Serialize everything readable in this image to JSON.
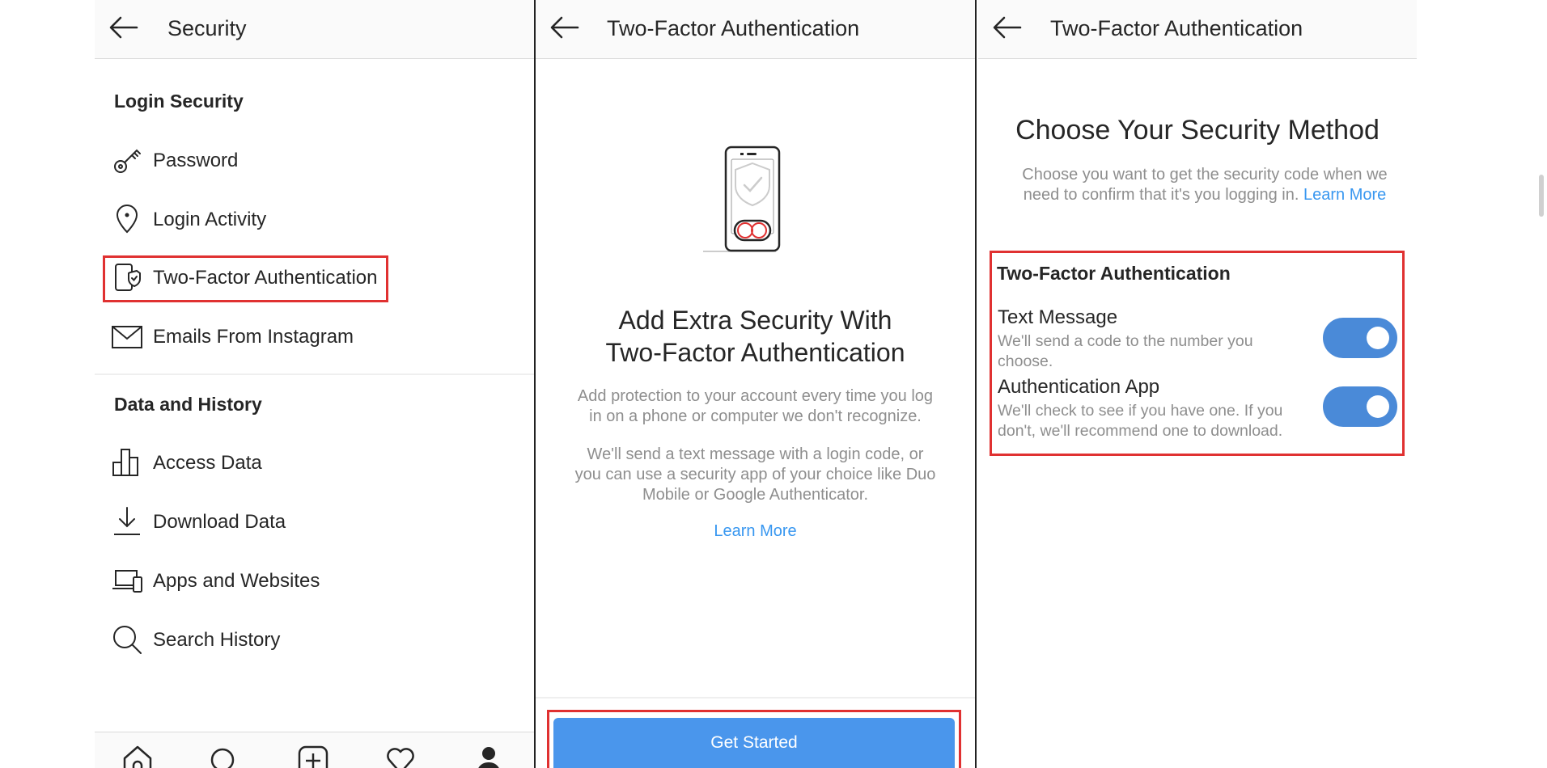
{
  "panel_security": {
    "title": "Security",
    "login_section_title": "Login Security",
    "login_items": [
      {
        "label": "Password",
        "icon": "key-icon"
      },
      {
        "label": "Login Activity",
        "icon": "location-pin-icon"
      },
      {
        "label": "Two-Factor Authentication",
        "icon": "phone-shield-icon"
      },
      {
        "label": "Emails From Instagram",
        "icon": "mail-icon"
      }
    ],
    "data_section_title": "Data and History",
    "data_items": [
      {
        "label": "Access Data",
        "icon": "bar-chart-icon"
      },
      {
        "label": "Download Data",
        "icon": "download-icon"
      },
      {
        "label": "Apps and Websites",
        "icon": "devices-icon"
      },
      {
        "label": "Search History",
        "icon": "search-icon"
      }
    ],
    "bottom_nav": [
      "home-icon",
      "search-icon",
      "new-post-icon",
      "heart-icon",
      "profile-icon"
    ]
  },
  "panel_intro": {
    "title": "Two-Factor Authentication",
    "headline_line1": "Add Extra Security With",
    "headline_line2": "Two-Factor Authentication",
    "para1_line1": "Add protection to your account every time you log",
    "para1_line2": "in on a phone or computer we don't recognize.",
    "para2_line1": "We'll send a text message with a login code, or",
    "para2_line2": "you can use a security app of your choice like Duo",
    "para2_line3": "Mobile or Google Authenticator.",
    "learn_more": "Learn More",
    "get_started": "Get Started"
  },
  "panel_method": {
    "title": "Two-Factor Authentication",
    "headline": "Choose Your Security Method",
    "desc_line1": "Choose you want to get the security code when we",
    "desc_line2": "need to confirm that it's you logging in.",
    "learn_more": "Learn More",
    "section_title": "Two-Factor Authentication",
    "options": [
      {
        "title": "Text Message",
        "desc_line1": "We'll send a code to the number you",
        "desc_line2": "choose.",
        "enabled": true
      },
      {
        "title": "Authentication App",
        "desc_line1": "We'll check to see if you have one. If you",
        "desc_line2": "don't, we'll recommend one to download.",
        "enabled": true
      }
    ]
  },
  "colors": {
    "highlight": "#e03131",
    "accent_blue": "#3897f0",
    "button_blue": "#4a96ec",
    "toggle_blue": "#4a8ad8"
  }
}
